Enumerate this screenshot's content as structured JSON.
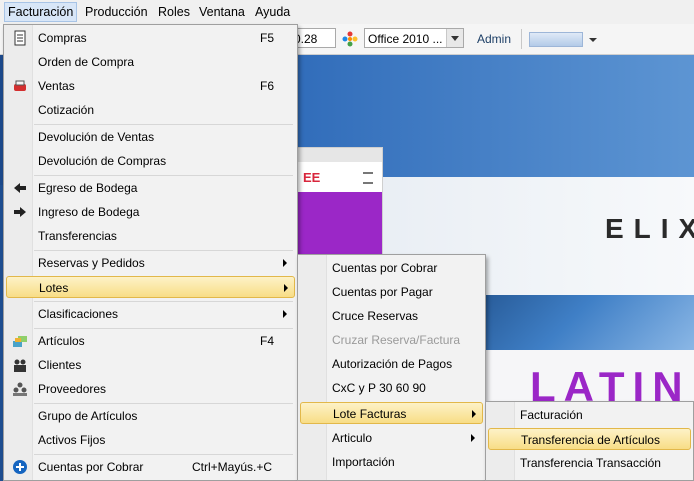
{
  "menubar": {
    "items": [
      "Facturación",
      "Producción",
      "Roles",
      "Ventana",
      "Ayuda"
    ]
  },
  "toolbar": {
    "field_value": "0.28",
    "theme_value": "Office 2010 ...",
    "user": "Admin"
  },
  "desktop": {
    "brand_partial": "EE",
    "banner_top": "ELIX",
    "banner_bottom": "LATIN"
  },
  "facturacion_menu": [
    {
      "label": "Compras",
      "shortcut": "F5",
      "icon": "purchases-icon"
    },
    {
      "label": "Orden de Compra"
    },
    {
      "label": "Ventas",
      "shortcut": "F6",
      "icon": "sales-icon"
    },
    {
      "label": "Cotización"
    },
    {
      "label": "Devolución de Ventas"
    },
    {
      "label": "Devolución de Compras"
    },
    {
      "label": "Egreso de Bodega",
      "icon": "exit-arrow-icon"
    },
    {
      "label": "Ingreso de Bodega",
      "icon": "enter-arrow-icon"
    },
    {
      "label": "Transferencias"
    },
    {
      "label": "Reservas y Pedidos",
      "submenu": true
    },
    {
      "label": "Lotes",
      "submenu": true,
      "selected": true
    },
    {
      "label": "Clasificaciones",
      "submenu": true
    },
    {
      "label": "Artículos",
      "shortcut": "F4",
      "icon": "articles-icon"
    },
    {
      "label": "Clientes",
      "icon": "clients-icon"
    },
    {
      "label": "Proveedores",
      "icon": "providers-icon"
    },
    {
      "label": "Grupo de Artículos"
    },
    {
      "label": "Activos Fijos"
    },
    {
      "label": "Cuentas por Cobrar",
      "shortcut": "Ctrl+Mayús.+C",
      "icon": "plus-circle-icon"
    }
  ],
  "lotes_menu": [
    {
      "label": "Cuentas por Cobrar"
    },
    {
      "label": "Cuentas por Pagar"
    },
    {
      "label": "Cruce Reservas"
    },
    {
      "label": "Cruzar Reserva/Factura",
      "disabled": true
    },
    {
      "label": "Autorización de Pagos"
    },
    {
      "label": "CxC y P 30 60 90"
    },
    {
      "label": "Lote Facturas",
      "submenu": true,
      "selected": true
    },
    {
      "label": "Articulo",
      "submenu": true
    },
    {
      "label": "Importación"
    }
  ],
  "lote_facturas_menu": [
    {
      "label": "Facturación"
    },
    {
      "label": "Transferencia de Artículos",
      "selected": true
    },
    {
      "label": "Transferencia Transacción"
    }
  ],
  "colors": {
    "highlight": "#f8dd86",
    "banner_purple": "#9b27c7",
    "desktop_blue": "#1f4f92"
  }
}
